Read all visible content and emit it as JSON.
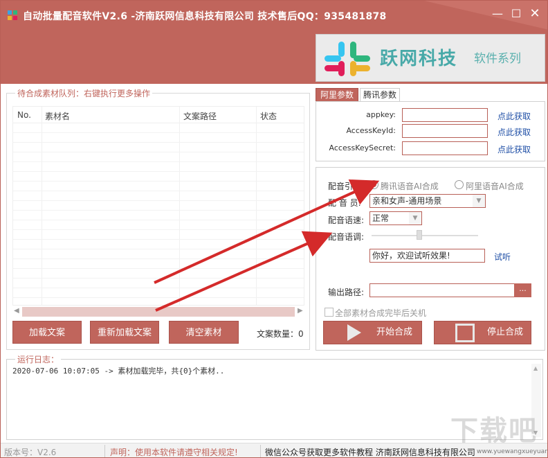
{
  "window": {
    "title": "自动批量配音软件V2.6 -济南跃网信息科技有限公司 技术售后QQ：935481878",
    "min": "—",
    "max": "☐",
    "close": "✕"
  },
  "banner": {
    "brand": "跃网科技",
    "subtitle": "软件系列"
  },
  "queue": {
    "legend": "待合成素材队列：右键执行更多操作",
    "columns": [
      "No.",
      "素材名",
      "文案路径",
      "状态"
    ],
    "rows": []
  },
  "buttons": {
    "load": "加载文案",
    "reload": "重新加载文案",
    "clear": "清空素材",
    "count_label": "文案数量：0"
  },
  "tabs": [
    {
      "label": "阿里参数",
      "active": true
    },
    {
      "label": "腾讯参数",
      "active": false
    }
  ],
  "params": {
    "appkey_label": "appkey:",
    "appkey_value": "",
    "accesskeyid_label": "AccessKeyId:",
    "accesskeyid_value": "",
    "accesskeysecret_label": "AccessKeySecret:",
    "accesskeysecret_value": "",
    "link": "点此获取"
  },
  "config": {
    "engine_label": "配音引擎:",
    "engine_options": [
      "腾讯语音AI合成",
      "阿里语音AI合成"
    ],
    "engine_selected": 0,
    "voice_label": "配 音 员:",
    "voice_value": "亲和女声-通用场景",
    "speed_label": "配音语速:",
    "speed_value": "正常",
    "tone_label": "配音语调:",
    "preview_text": "你好，欢迎试听效果!",
    "listen_link": "试听",
    "output_label": "输出路径:",
    "output_value": "",
    "browse": "...",
    "shutdown_label": "全部素材合成完毕后关机",
    "start": "开始合成",
    "stop": "停止合成"
  },
  "log": {
    "legend": "运行日志：",
    "lines": [
      "2020-07-06 10:07:05 -> 素材加载完毕，共{0}个素材.."
    ]
  },
  "status": {
    "version": "版本号：V2.6",
    "notice": "声明：使用本软件请遵守相关规定!",
    "promo": "微信公众号获取更多软件教程 济南跃网信息科技有限公司",
    "watermark": "下载吧",
    "watermark_url": "www.yuewangxueyuan"
  },
  "colors": {
    "accent": "#c0655c",
    "link": "#1f4fa6",
    "brand": "#47a9a8",
    "annotation_arrow": "#d42a2a"
  }
}
